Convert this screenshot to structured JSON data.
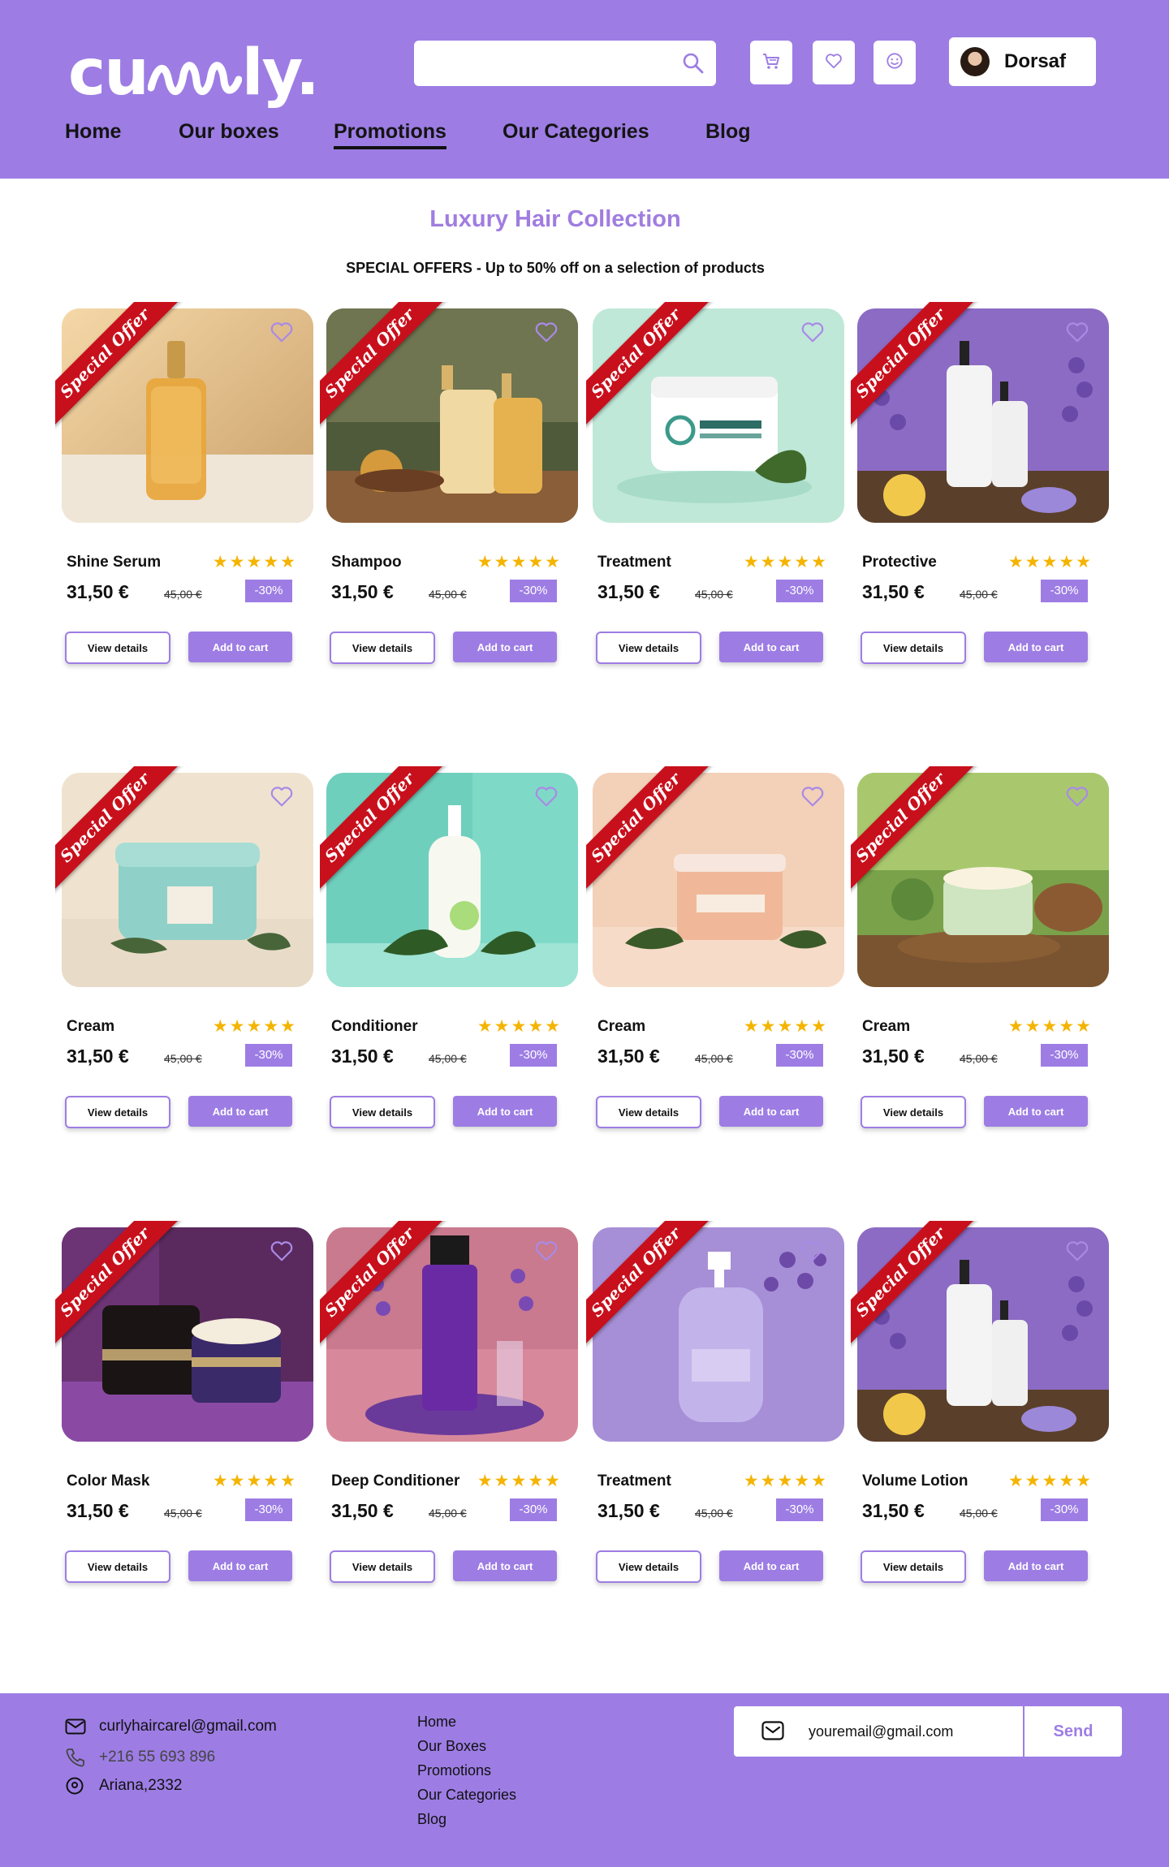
{
  "brand": {
    "logo_left": "cu",
    "logo_right": "ly."
  },
  "header": {
    "search_placeholder": "",
    "icons": [
      "search-icon",
      "cart-icon",
      "heart-icon",
      "smiley-icon"
    ],
    "user_name": "Dorsaf"
  },
  "nav": {
    "items": [
      {
        "label": "Home",
        "active": false
      },
      {
        "label": "Our boxes",
        "active": false
      },
      {
        "label": "Promotions",
        "active": true
      },
      {
        "label": "Our Categories",
        "active": false
      },
      {
        "label": "Blog",
        "active": false
      }
    ]
  },
  "page": {
    "title": "Luxury Hair Collection",
    "subtitle": "SPECIAL OFFERS - Up to 50% off on a selection of products"
  },
  "card_common": {
    "ribbon": "Special Offer",
    "stars": "★★★★★",
    "rating": 5,
    "view_label": "View details",
    "cart_label": "Add to cart"
  },
  "products": [
    {
      "name": "Shine Serum",
      "price": "31,50 €",
      "old_price": "45,00 €",
      "discount": "-30%"
    },
    {
      "name": "Shampoo",
      "price": "31,50 €",
      "old_price": "45,00 €",
      "discount": "-30%"
    },
    {
      "name": "Treatment",
      "price": "31,50 €",
      "old_price": "45,00 €",
      "discount": "-30%"
    },
    {
      "name": "Protective",
      "price": "31,50 €",
      "old_price": "45,00 €",
      "discount": "-30%"
    },
    {
      "name": "Cream",
      "price": "31,50 €",
      "old_price": "45,00 €",
      "discount": "-30%"
    },
    {
      "name": "Conditioner",
      "price": "31,50 €",
      "old_price": "45,00 €",
      "discount": "-30%"
    },
    {
      "name": "Cream",
      "price": "31,50 €",
      "old_price": "45,00 €",
      "discount": "-30%"
    },
    {
      "name": "Cream",
      "price": "31,50 €",
      "old_price": "45,00 €",
      "discount": "-30%"
    },
    {
      "name": "Color Mask",
      "price": "31,50 €",
      "old_price": "45,00 €",
      "discount": "-30%"
    },
    {
      "name": "Deep Conditioner",
      "price": "31,50 €",
      "old_price": "45,00 €",
      "discount": "-30%"
    },
    {
      "name": "Treatment",
      "price": "31,50 €",
      "old_price": "45,00 €",
      "discount": "-30%"
    },
    {
      "name": "Volume Lotion",
      "price": "31,50 €",
      "old_price": "45,00 €",
      "discount": "-30%"
    }
  ],
  "footer": {
    "email": "curlyhaircarel@gmail.com",
    "phone": "+216 55 693 896",
    "address": "Ariana,2332",
    "links": [
      "Home",
      "Our Boxes",
      "Promotions",
      "Our Categories",
      "Blog"
    ],
    "newsletter_value": "youremail@gmail.com",
    "send_label": "Send"
  },
  "colors": {
    "accent": "#9d7de4",
    "ribbon": "#c8101c",
    "star": "#f4b400"
  }
}
